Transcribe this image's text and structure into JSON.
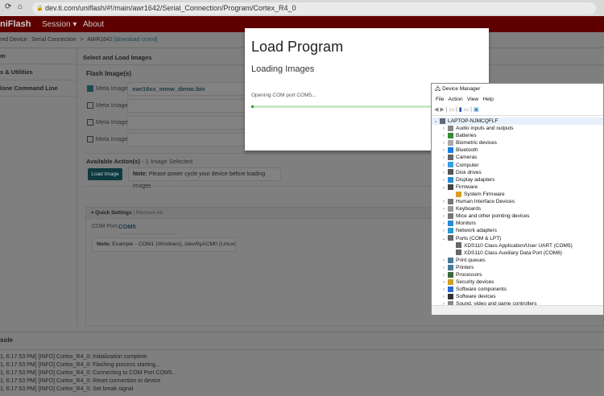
{
  "browser": {
    "url": "dev.ti.com/uniflash/#!/main/awr1642/Serial_Connection/Program/Cortex_R4_0"
  },
  "header": {
    "app": "niFlash",
    "menu": [
      "Session ▾",
      "About"
    ]
  },
  "breadcrumb": {
    "device": "red Device : Serial Connection",
    "sep": ">",
    "chip": "AWR1642",
    "link": "[download ccxml]"
  },
  "sidebar": {
    "items": [
      "m",
      "s & Utilities",
      "lone Command Line"
    ]
  },
  "main": {
    "section_title": "Select and Load Images",
    "flash_title": "Flash Image(s)",
    "images": [
      {
        "label": "Meta Image 1",
        "checked": true,
        "value": "xwr16xx_mmw_demo.bin"
      },
      {
        "label": "Meta Image 2",
        "checked": false,
        "value": ""
      },
      {
        "label": "Meta Image 3",
        "checked": false,
        "value": ""
      },
      {
        "label": "Meta Image 4",
        "checked": false,
        "value": ""
      }
    ],
    "actions_title": "Available Action(s)",
    "actions_sub": " - 1 Image Selected",
    "load_button": "Load Image",
    "note_label": "Note:",
    "note_text": " Please power cycle your device before loading images",
    "quick_settings": {
      "title": "Quick Settings",
      "remove": "| Remove All",
      "com_label": "COM Port:",
      "com_value": "COM5",
      "note_label": "Note:",
      "note_text": " Example - COM1 (Windows), /dev/ttyACM0 (Linux)"
    }
  },
  "console": {
    "title": "sole",
    "lines": [
      "1, 6:17:53 PM] [INFO] Cortex_R4_0: Initialization complete.",
      "1, 6:17:53 PM] [INFO] Cortex_R4_0: Flashing process starting...",
      "1, 6:17:53 PM] [INFO] Cortex_R4_0: Connecting to COM Port COM5...",
      "1, 6:17:53 PM] [INFO] Cortex_R4_0: Reset connection to device",
      "1, 6:17:53 PM] [INFO] Cortex_R4_0: Set break signal"
    ]
  },
  "modal": {
    "title": "Load Program",
    "subtitle": "Loading Images",
    "status": "Opening COM port COM5...",
    "progress_percent": 1,
    "progress_color": "#2ea02e"
  },
  "device_manager": {
    "title": "Device Manager",
    "menu": [
      "File",
      "Action",
      "View",
      "Help"
    ],
    "root": "LAPTOP-NJMCQFLF",
    "nodes": [
      {
        "label": "Audio inputs and outputs",
        "state": "collapsed",
        "icon": "speaker-icon",
        "color": "#888"
      },
      {
        "label": "Batteries",
        "state": "collapsed",
        "icon": "battery-icon",
        "color": "#3a8a3a"
      },
      {
        "label": "Biometric devices",
        "state": "collapsed",
        "icon": "fingerprint-icon",
        "color": "#aaa"
      },
      {
        "label": "Bluetooth",
        "state": "collapsed",
        "icon": "bluetooth-icon",
        "color": "#1a7ee0"
      },
      {
        "label": "Cameras",
        "state": "collapsed",
        "icon": "camera-icon",
        "color": "#666"
      },
      {
        "label": "Computer",
        "state": "collapsed",
        "icon": "computer-icon",
        "color": "#3aa0e0"
      },
      {
        "label": "Disk drives",
        "state": "collapsed",
        "icon": "disk-icon",
        "color": "#555"
      },
      {
        "label": "Display adapters",
        "state": "collapsed",
        "icon": "display-icon",
        "color": "#2a8ad0"
      },
      {
        "label": "Firmware",
        "state": "expanded",
        "icon": "firmware-icon",
        "color": "#444"
      },
      {
        "label": "System Firmware",
        "state": "child",
        "icon": "warning-icon",
        "color": "#d8a020"
      },
      {
        "label": "Human Interface Devices",
        "state": "collapsed",
        "icon": "hid-icon",
        "color": "#777"
      },
      {
        "label": "Keyboards",
        "state": "collapsed",
        "icon": "keyboard-icon",
        "color": "#999"
      },
      {
        "label": "Mice and other pointing devices",
        "state": "collapsed",
        "icon": "mouse-icon",
        "color": "#777"
      },
      {
        "label": "Monitors",
        "state": "collapsed",
        "icon": "monitor-icon",
        "color": "#2a8ad0"
      },
      {
        "label": "Network adapters",
        "state": "collapsed",
        "icon": "network-icon",
        "color": "#2a9ad0"
      },
      {
        "label": "Ports (COM & LPT)",
        "state": "expanded",
        "icon": "port-icon",
        "color": "#666"
      },
      {
        "label": "XDS110 Class Application/User UART (COM5)",
        "state": "child",
        "icon": "port-icon",
        "color": "#666"
      },
      {
        "label": "XDS110 Class Auxiliary Data Port (COM6)",
        "state": "child",
        "icon": "port-icon",
        "color": "#666"
      },
      {
        "label": "Print queues",
        "state": "collapsed",
        "icon": "printer-icon",
        "color": "#4a7a9a"
      },
      {
        "label": "Printers",
        "state": "collapsed",
        "icon": "printer-icon",
        "color": "#4a7a9a"
      },
      {
        "label": "Processors",
        "state": "collapsed",
        "icon": "processor-icon",
        "color": "#3a6a3a"
      },
      {
        "label": "Security devices",
        "state": "collapsed",
        "icon": "security-icon",
        "color": "#d0a020"
      },
      {
        "label": "Software components",
        "state": "collapsed",
        "icon": "software-component-icon",
        "color": "#2a6ad0"
      },
      {
        "label": "Software devices",
        "state": "collapsed",
        "icon": "software-device-icon",
        "color": "#333"
      },
      {
        "label": "Sound, video and game controllers",
        "state": "collapsed",
        "icon": "speaker-icon",
        "color": "#888"
      }
    ]
  }
}
